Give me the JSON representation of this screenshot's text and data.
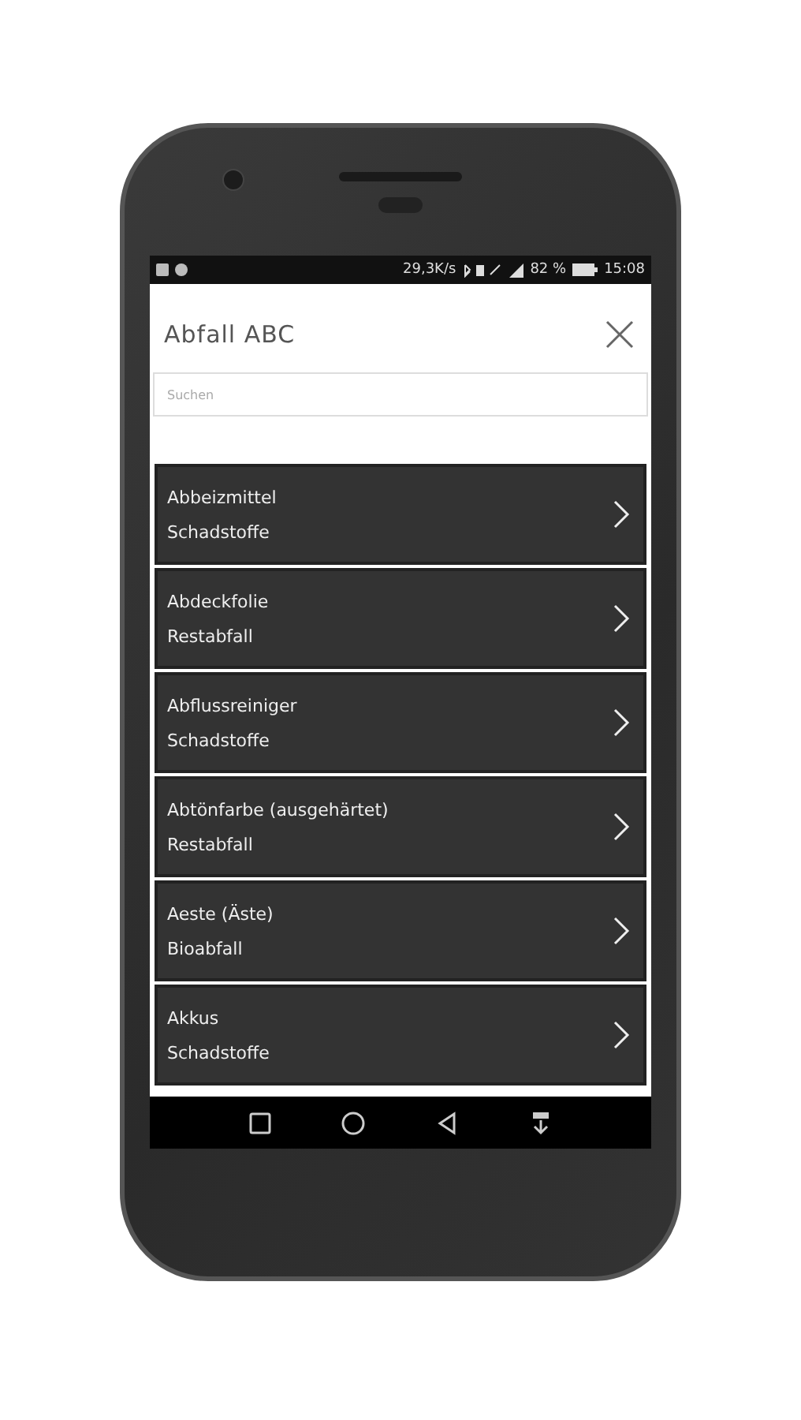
{
  "status_bar": {
    "speed": "29,3K/s",
    "battery": "82 %",
    "time": "15:08"
  },
  "header": {
    "title": "Abfall ABC"
  },
  "search": {
    "placeholder": "Suchen"
  },
  "items": [
    {
      "name": "Abbeizmittel",
      "category": "Schadstoffe"
    },
    {
      "name": "Abdeckfolie",
      "category": "Restabfall"
    },
    {
      "name": "Abflussreiniger",
      "category": "Schadstoffe"
    },
    {
      "name": "Abtönfarbe (ausgehärtet)",
      "category": "Restabfall"
    },
    {
      "name": "Aeste (Äste)",
      "category": "Bioabfall"
    },
    {
      "name": "Akkus",
      "category": "Schadstoffe"
    }
  ]
}
